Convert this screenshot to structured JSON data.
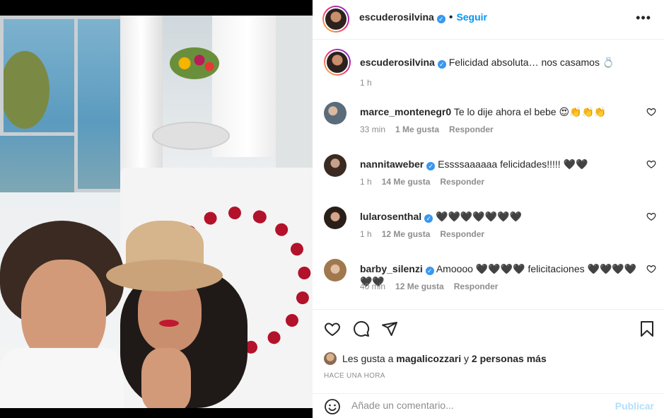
{
  "header": {
    "username": "escuderosilvina",
    "follow_label": "Seguir",
    "separator": "•",
    "more_label": "•••"
  },
  "caption": {
    "username": "escuderosilvina",
    "text": "Felicidad absoluta… nos casamos 💍",
    "time": "1 h"
  },
  "comments": [
    {
      "username": "marce_montenegr0",
      "verified": false,
      "text": "Te lo dije ahora el bebe 😍👏👏👏",
      "time": "33 min",
      "likes": "1 Me gusta",
      "reply": "Responder"
    },
    {
      "username": "nannitaweber",
      "verified": true,
      "text": "Essssaaaaaa felicidades!!!!! 🖤🖤",
      "time": "1 h",
      "likes": "14 Me gusta",
      "reply": "Responder"
    },
    {
      "username": "lularosenthal",
      "verified": true,
      "text": "🖤🖤🖤🖤🖤🖤🖤",
      "time": "1 h",
      "likes": "12 Me gusta",
      "reply": "Responder"
    },
    {
      "username": "barby_silenzi",
      "verified": true,
      "text": "Amoooo 🖤🖤🖤🖤 felicitaciones 🖤🖤🖤🖤🖤🖤",
      "time": "40 min",
      "likes": "12 Me gusta",
      "reply": "Responder"
    }
  ],
  "likes": {
    "prefix": "Les gusta a",
    "user": "magalicozzari",
    "joiner": "y",
    "others": "2 personas más"
  },
  "timestamp": "HACE UNA HORA",
  "composer": {
    "placeholder": "Añade un comentario...",
    "publish_label": "Publicar"
  },
  "icons": {
    "like": "heart-icon",
    "comment": "comment-icon",
    "share": "paper-plane-icon",
    "save": "bookmark-icon",
    "emoji": "emoji-icon"
  },
  "colors": {
    "accent": "#0095f6",
    "verified": "#3897f0",
    "publish_disabled": "#b2dffc",
    "text": "#262626",
    "secondary": "#8e8e8e"
  }
}
